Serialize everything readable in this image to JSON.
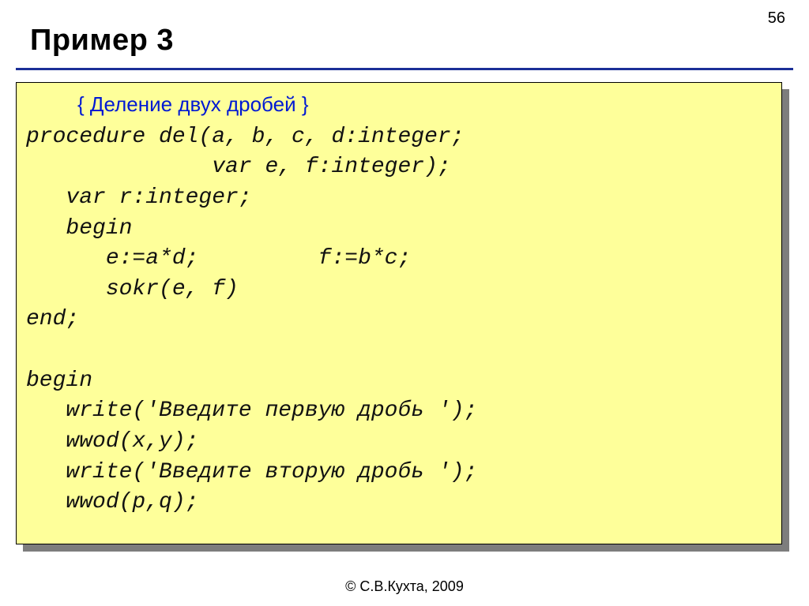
{
  "page_number": "56",
  "title": "Пример 3",
  "footer": "© С.В.Кухта, 2009",
  "code": {
    "comment_line": "         { Деление двух дробей }",
    "l1": "procedure del(a, b, c, d:integer;",
    "l2": "              var e, f:integer);",
    "l3": "   var r:integer;",
    "l4": "   begin",
    "l5": "      e:=a*d;         f:=b*c;",
    "l6": "      sokr(e, f)",
    "l7": "end;",
    "l8": "",
    "l9": "begin",
    "l10": "   write('Введите первую дробь ');",
    "l11": "   wwod(x,y);",
    "l12": "   write('Введите вторую дробь ');",
    "l13": "   wwod(p,q);"
  }
}
